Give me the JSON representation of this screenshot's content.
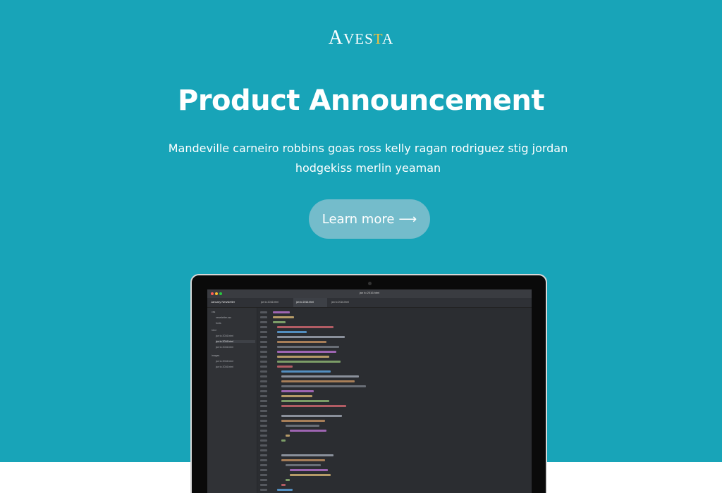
{
  "brand": {
    "logo_first": "A",
    "logo_mid": "VES",
    "logo_accent": "T",
    "logo_end": "A"
  },
  "hero": {
    "title": "Product Announcement",
    "subtitle": "Mandeville carneiro robbins goas ross kelly ragan rodriguez stig jordan hodgekiss merlin yeaman",
    "cta_label": "Learn more",
    "cta_arrow": "⟶"
  },
  "colors": {
    "hero_bg": "#18a4b8",
    "cta_bg": "#74bccb",
    "logo_accent": "#f6c23e",
    "editor_bg": "#2b2d31"
  },
  "editor": {
    "window_title": "jan to 2016.html",
    "project_label": "January Newsletter",
    "tabs": [
      "jan to 2016.html",
      "jan to 2016.html",
      "jan to 2016.html"
    ],
    "sidebar_items": [
      "css",
      "newsletter.css",
      "fonts",
      "html",
      "jan to 2016.html",
      "jan to 2016.html",
      "jan to 2016.html",
      "images",
      "jan to 2016.html",
      "jan to 2016.html"
    ]
  }
}
